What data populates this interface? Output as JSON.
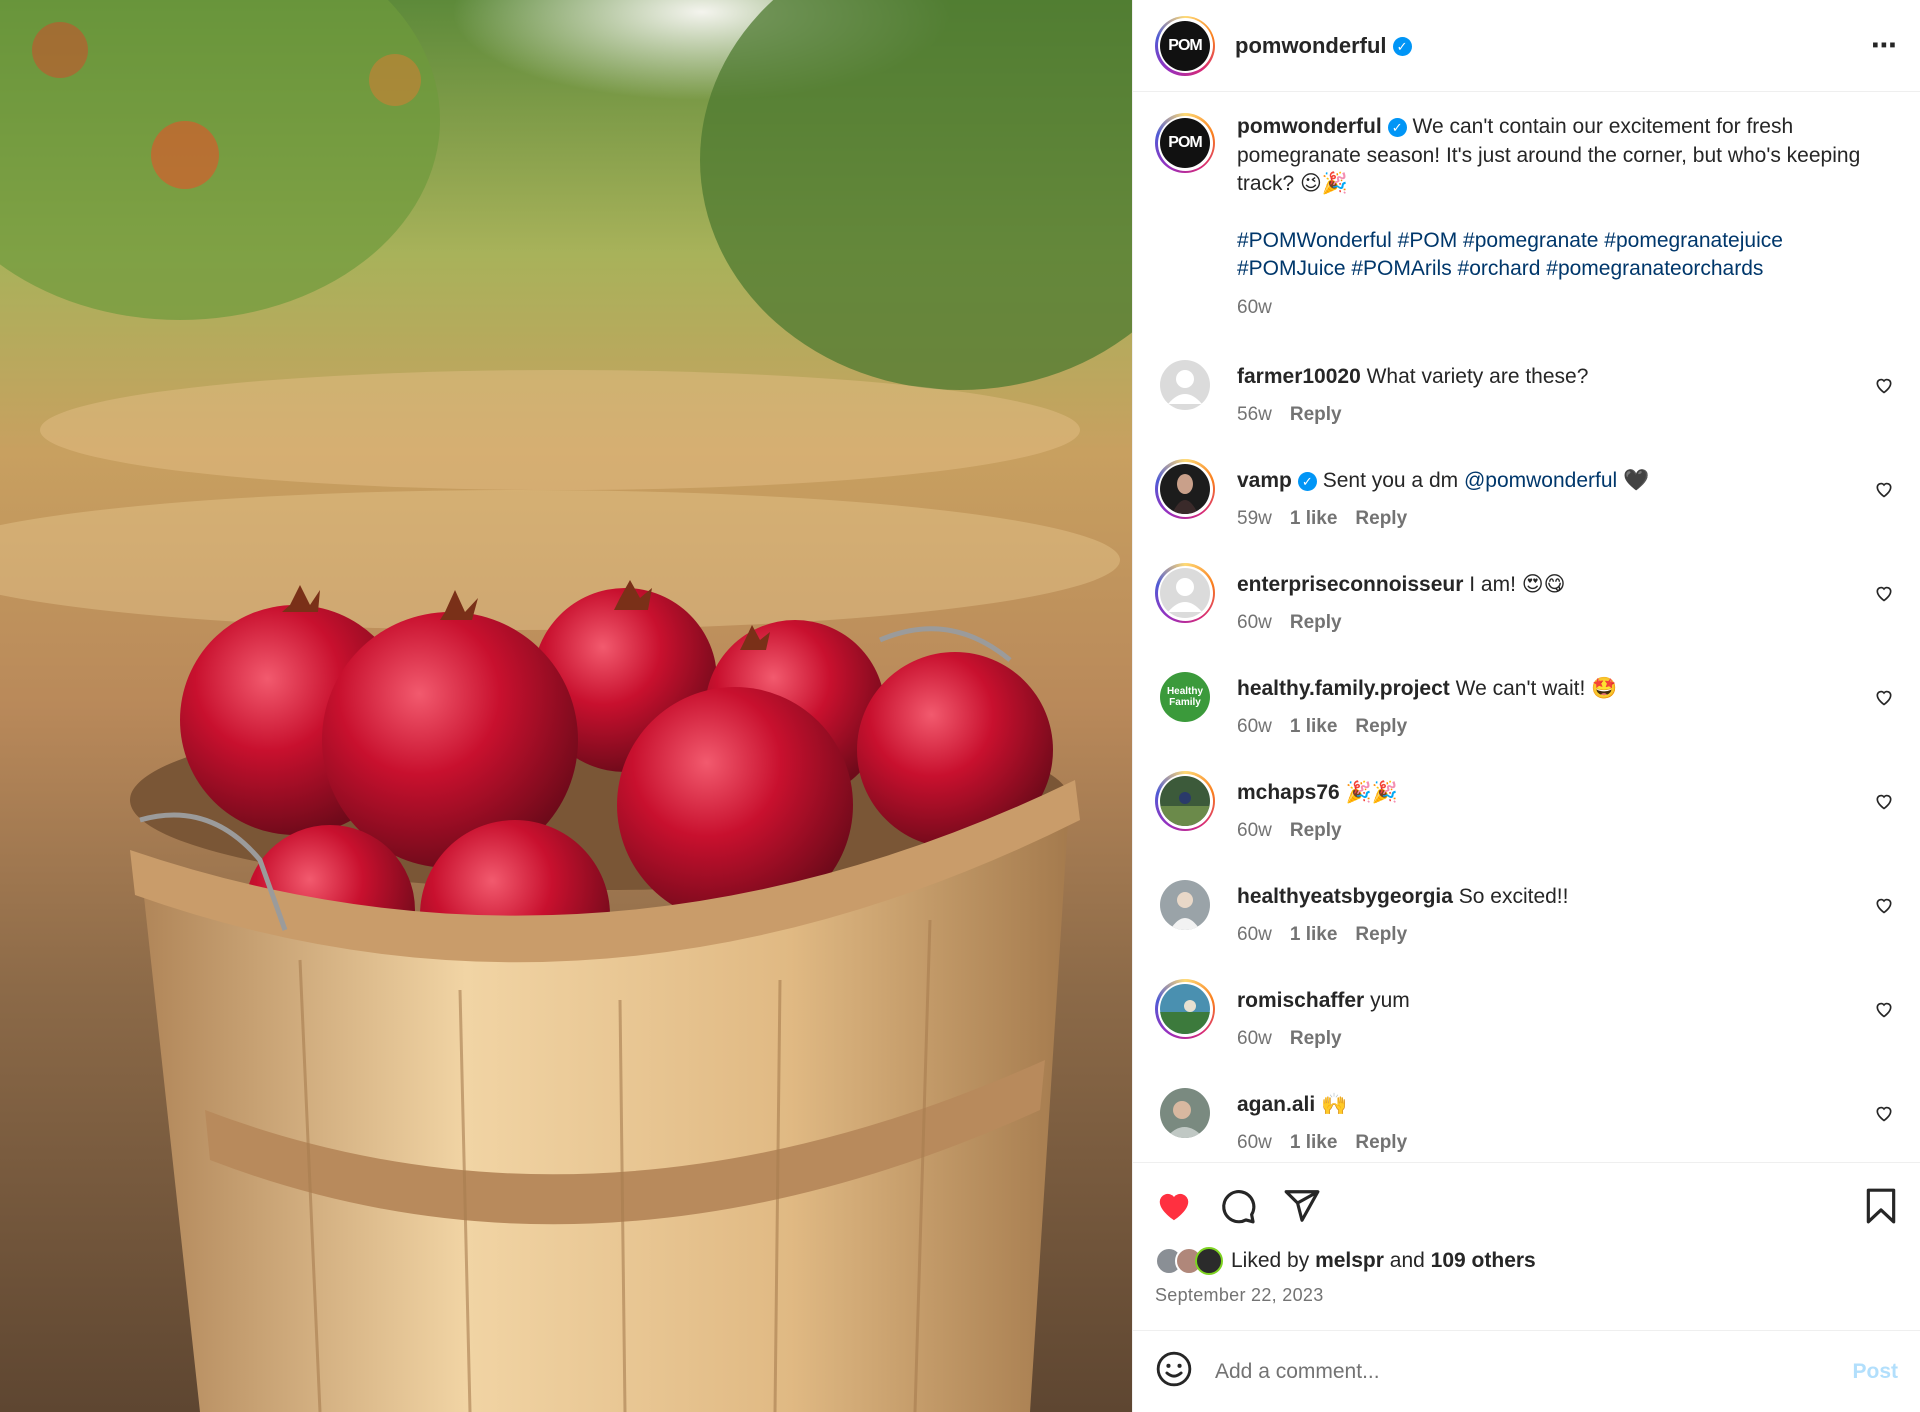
{
  "post": {
    "author": "pomwonderful",
    "logo_text": "POM",
    "caption_text": "We can't contain our excitement for fresh pomegranate season! It's just around the corner, but who's keeping track? 😉🎉",
    "hashtags": "#POMWonderful #POM #pomegranate #pomegranatejuice #POMJuice #POMArils #orchard #pomegranateorchards",
    "time": "60w"
  },
  "header": {
    "username": "pomwonderful",
    "more_icon": "more-horizontal-icon"
  },
  "comments": [
    {
      "username": "farmer10020",
      "text": "What variety are these?",
      "time": "56w",
      "likes": "",
      "reply": "Reply",
      "verified": false
    },
    {
      "username": "vamp",
      "text": "Sent you a dm",
      "mention": "@pomwonderful",
      "suffix": "🖤",
      "time": "59w",
      "likes": "1 like",
      "reply": "Reply",
      "verified": true
    },
    {
      "username": "enterpriseconnoisseur",
      "text": "I am! 😍😋",
      "time": "60w",
      "likes": "",
      "reply": "Reply",
      "verified": false
    },
    {
      "username": "healthy.family.project",
      "text": "We can't wait! 🤩",
      "time": "60w",
      "likes": "1 like",
      "reply": "Reply",
      "verified": false
    },
    {
      "username": "mchaps76",
      "text": "🎉🎉",
      "time": "60w",
      "likes": "",
      "reply": "Reply",
      "verified": false
    },
    {
      "username": "healthyeatsbygeorgia",
      "text": "So excited!!",
      "time": "60w",
      "likes": "1 like",
      "reply": "Reply",
      "verified": false
    },
    {
      "username": "romischaffer",
      "text": "yum",
      "time": "60w",
      "likes": "",
      "reply": "Reply",
      "verified": false
    },
    {
      "username": "agan.ali",
      "text": "🙌",
      "time": "60w",
      "likes": "1 like",
      "reply": "Reply",
      "verified": false
    }
  ],
  "healthy_avatar_text": "Healthy Family",
  "likes": {
    "prefix": "Liked by",
    "user": "melspr",
    "and": "and",
    "others": "109 others"
  },
  "date": "September 22, 2023",
  "add_comment": {
    "placeholder": "Add a comment...",
    "post_label": "Post"
  },
  "colors": {
    "like_red": "#ff3040",
    "link_blue": "#00376b",
    "verified_blue": "#0095f6",
    "post_disabled": "#b2dffc"
  }
}
